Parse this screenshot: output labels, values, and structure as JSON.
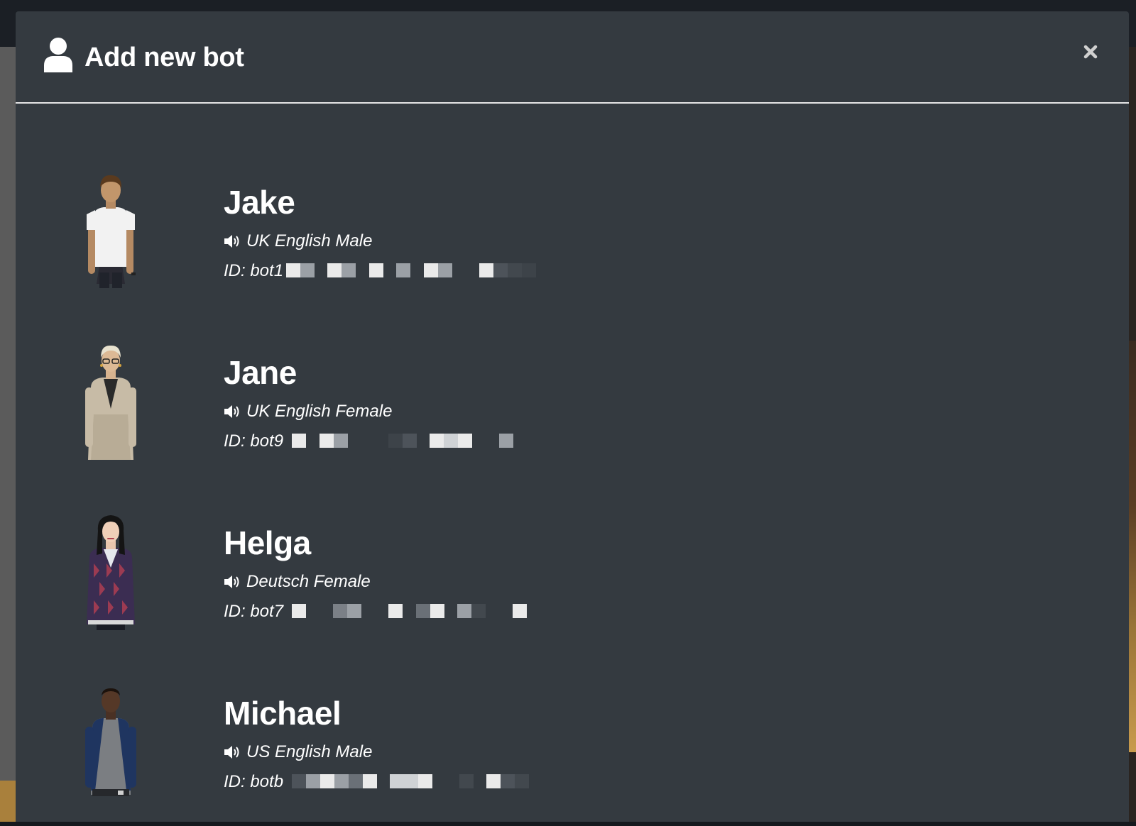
{
  "modal": {
    "title": "Add new bot",
    "header_icon": "user-icon",
    "close_icon": "close-icon"
  },
  "bots": [
    {
      "name": "Jake",
      "voice": "UK English Male",
      "id_prefix": "ID: bot1",
      "avatar": "male-avatar-white-tshirt",
      "id_redacted": true
    },
    {
      "name": "Jane",
      "voice": "UK English Female",
      "id_prefix": "ID: bot9",
      "avatar": "female-avatar-beige-cardigan",
      "id_redacted": true
    },
    {
      "name": "Helga",
      "voice": "Deutsch Female",
      "id_prefix": "ID: bot7",
      "avatar": "female-avatar-plaid-jacket",
      "id_redacted": true
    },
    {
      "name": "Michael",
      "voice": "US English Male",
      "id_prefix": "ID: botb",
      "avatar": "male-avatar-raglan-shirt",
      "id_redacted": true
    }
  ],
  "colors": {
    "modal_bg": "#343a40",
    "page_bg": "#15191e",
    "text": "#ffffff",
    "divider": "#e6e6e6"
  }
}
